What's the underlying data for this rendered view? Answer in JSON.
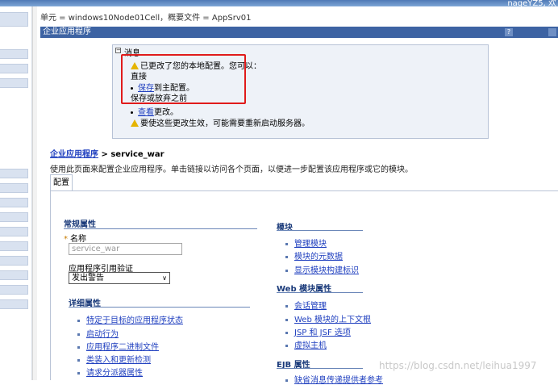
{
  "header": {
    "user_text": "nageYZ5, 欢"
  },
  "breadcrumb": "单元 = windows10Node01Cell，概要文件 = AppSrv01",
  "panel_title": "企业应用程序",
  "message": {
    "title": "消息",
    "line1": "已更改了您的本地配置。您可以：",
    "line2": "直接",
    "save_link": "保存",
    "save_suffix": "到主配置。",
    "line4": "保存或放弃之前",
    "view_link": "查看",
    "view_suffix": "更改。",
    "line6": "要使这些更改生效，可能需要重新启动服务器。"
  },
  "page": {
    "crumb_link": "企业应用程序",
    "crumb_sep": " > ",
    "crumb_current": "service_war",
    "description": "使用此页面来配置企业应用程序。单击链接以访问各个页面，以便进一步配置该应用程序或它的模块。",
    "tab": "配置"
  },
  "general": {
    "heading": "常规属性",
    "name_label": "名称",
    "name_value": "service_war",
    "ref_label": "应用程序引用验证",
    "ref_value": "发出警告"
  },
  "detail": {
    "heading": "详细属性",
    "items": [
      "特定于目标的应用程序状态",
      "启动行为",
      "应用程序二进制文件",
      "类装入和更新检测",
      "请求分派器属性"
    ]
  },
  "modules": {
    "heading": "模块",
    "items": [
      "管理模块",
      "模块的元数据",
      "显示模块构建标识"
    ]
  },
  "web": {
    "heading": "Web 模块属性",
    "items": [
      "会话管理",
      "Web 模块的上下文根",
      "JSP 和 JSF 选项",
      "虚拟主机"
    ]
  },
  "ejb": {
    "heading": "EJB 属性",
    "items": [
      "缺省消息传递提供者参考"
    ]
  },
  "watermark": "https://blog.csdn.net/leihua1997"
}
